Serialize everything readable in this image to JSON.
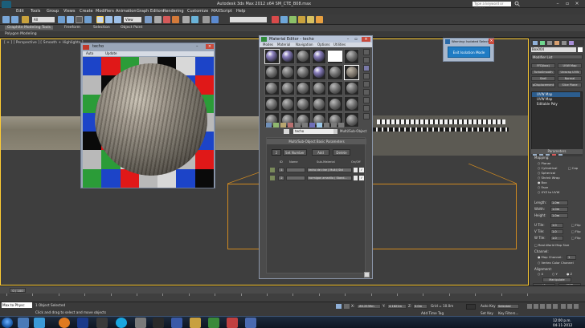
{
  "app": {
    "title": "Autodesk 3ds Max  2012 x64     SM_CTE_B08.max",
    "search_placeholder": "Type a keyword or phrase"
  },
  "menu": [
    "Edit",
    "Tools",
    "Group",
    "Views",
    "Create",
    "Modifiers",
    "Animation",
    "Graph Editors",
    "Rendering",
    "Customize",
    "MAXScript",
    "Help"
  ],
  "toolbar": {
    "selection_filter": "All",
    "view_dropdown": "View"
  },
  "ribbon": {
    "tabs": [
      "Graphite Modeling Tools",
      "Freeform",
      "Selection",
      "Object Paint"
    ],
    "sub": "Polygon Modeling"
  },
  "viewport": {
    "label": "[ + ] [ Perspective ] [ Smooth + Highlights ]"
  },
  "checker_window": {
    "title": "techo",
    "toolbar_left": "Auto",
    "toolbar_right": "Update"
  },
  "material_editor": {
    "title": "Material Editor - techo",
    "menus": [
      "Modes",
      "Material",
      "Navigation",
      "Options",
      "Utilities"
    ],
    "material_name": "techo",
    "material_type": "Multi/Sub-Object",
    "rollout_title": "Multi/Sub-Object Basic Parameters",
    "set_number": "Set Number",
    "add": "Add",
    "delete": "Delete",
    "number_label": "2",
    "column_id": "ID",
    "column_name": "Name",
    "column_sub": "Sub-Material",
    "column_onoff": "On/Off",
    "rows": [
      {
        "id": "1",
        "name": "",
        "sub": "techo de cine ( Multi) Std"
      },
      {
        "id": "2",
        "name": "",
        "sub": "hormigon amarillo ( Stand..."
      }
    ]
  },
  "warning": {
    "title": "Warning: Isolated Selecti...",
    "button": "Exit Isolation Mode"
  },
  "command_panel": {
    "object_name": "Box004",
    "modifier_list": "Modifier List",
    "buttons": [
      "FFD(box)",
      "UVW Map",
      "TurboSmooth",
      "Unwrap UVW",
      "Shell",
      "Normal",
      "pDisplacement",
      "Slice Plane"
    ],
    "stack": [
      "UVW Map",
      "UVW Map",
      "Editable Poly"
    ],
    "rollout": "Parameters",
    "mapping_label": "Mapping:",
    "mapping_options": [
      "Planar",
      "Cylindrical",
      "Spherical",
      "Shrink Wrap",
      "Box",
      "Face",
      "XYZ to UVW"
    ],
    "cap": "Cap",
    "length_label": "Length:",
    "length_value": "1.0m",
    "width_label": "Width:",
    "width_value": "1.0m",
    "height_label": "Height:",
    "height_value": "1.0m",
    "utile_label": "U Tile:",
    "utile_value": "1.0",
    "vtile_label": "V Tile:",
    "vtile_value": "1.0",
    "wtile_label": "W Tile:",
    "wtile_value": "1.0",
    "flip": "Flip",
    "real_world": "Real-World Map Size",
    "channel_label": "Channel:",
    "map_channel": "Map Channel:",
    "map_channel_value": "1",
    "vertex_color": "Vertex Color Channel",
    "alignment_label": "Alignment:",
    "axis": [
      "X",
      "Y",
      "Z"
    ],
    "manipulate": "Manipulate",
    "fit": "Fit",
    "center": "Center",
    "bitmap_fit": "Bitmap Fit",
    "normal_align": "Normal Align"
  },
  "timeline": {
    "slider": "0 / 100",
    "ticks": [
      "0",
      "5",
      "10",
      "15",
      "20",
      "25",
      "30",
      "35",
      "40",
      "45",
      "50",
      "55",
      "60",
      "65",
      "70",
      "75",
      "80",
      "85",
      "90",
      "95",
      "100"
    ]
  },
  "status": {
    "maxscript": "Max to Physc",
    "selection": "1 Object Selected",
    "prompt": "Click and drag to select and move objects",
    "x": "-80.2539m",
    "y": "4.1621m",
    "z": "0.0m",
    "grid": "Grid = 10.0m",
    "add_time_tag": "Add Time Tag",
    "auto_key": "Auto Key",
    "selected": "Selected",
    "set_key": "Set Key",
    "key_filters": "Key Filters..."
  },
  "taskbar": {
    "time": "12:00 p.m.",
    "date": "04-11-2012"
  },
  "colors": {
    "checker": [
      "#1c44c8",
      "#e01818",
      "#2b9c38",
      "#b9b9b9",
      "#0a0a0a",
      "#d8d8d8",
      "#8a2a9a"
    ],
    "selection_border": "#ffcc33",
    "warning_button": "#1f7cc4"
  }
}
